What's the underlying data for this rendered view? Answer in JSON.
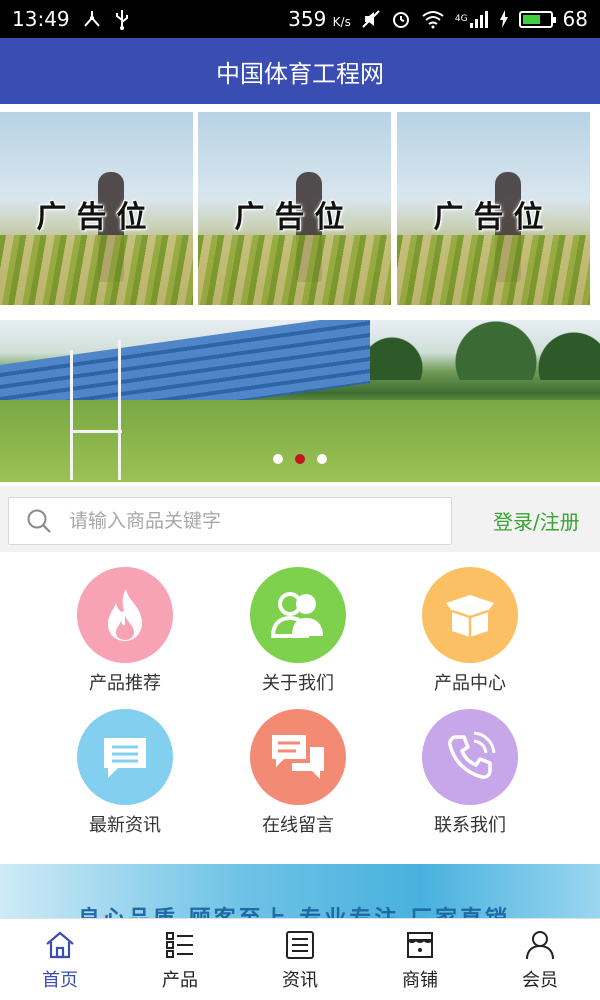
{
  "status_bar": {
    "time": "13:49",
    "net_speed": "359",
    "net_unit": "K/s",
    "network_type": "4G",
    "battery": "68"
  },
  "header": {
    "title": "中国体育工程网"
  },
  "ads": [
    {
      "label": "广告位"
    },
    {
      "label": "广告位"
    },
    {
      "label": "广告位"
    }
  ],
  "banner": {
    "slide_count": 3,
    "active_slide": 2
  },
  "search": {
    "placeholder": "请输入商品关键字",
    "value": "",
    "login_label": "登录/注册"
  },
  "grid": {
    "items": [
      {
        "label": "产品推荐",
        "icon": "fire-icon",
        "color": "#f7a3b4"
      },
      {
        "label": "关于我们",
        "icon": "users-icon",
        "color": "#7ed14d"
      },
      {
        "label": "产品中心",
        "icon": "box-icon",
        "color": "#fcc064"
      },
      {
        "label": "最新资讯",
        "icon": "message-icon",
        "color": "#82cff0"
      },
      {
        "label": "在线留言",
        "icon": "chat-icon",
        "color": "#f38a73"
      },
      {
        "label": "联系我们",
        "icon": "phone-icon",
        "color": "#c8a6ea"
      }
    ]
  },
  "bottom_ad": {
    "text": "良心品质 顾客至上 专业专注 厂家直销"
  },
  "tabs": [
    {
      "label": "首页",
      "icon": "home-icon",
      "active": true
    },
    {
      "label": "产品",
      "icon": "list-icon",
      "active": false
    },
    {
      "label": "资讯",
      "icon": "news-icon",
      "active": false
    },
    {
      "label": "商铺",
      "icon": "store-icon",
      "active": false
    },
    {
      "label": "会员",
      "icon": "user-icon",
      "active": false
    }
  ],
  "colors": {
    "header": "#3a4db2",
    "accent_green": "#3aa435",
    "active_dot": "#c0161c",
    "active_tab": "#3a4db2"
  }
}
